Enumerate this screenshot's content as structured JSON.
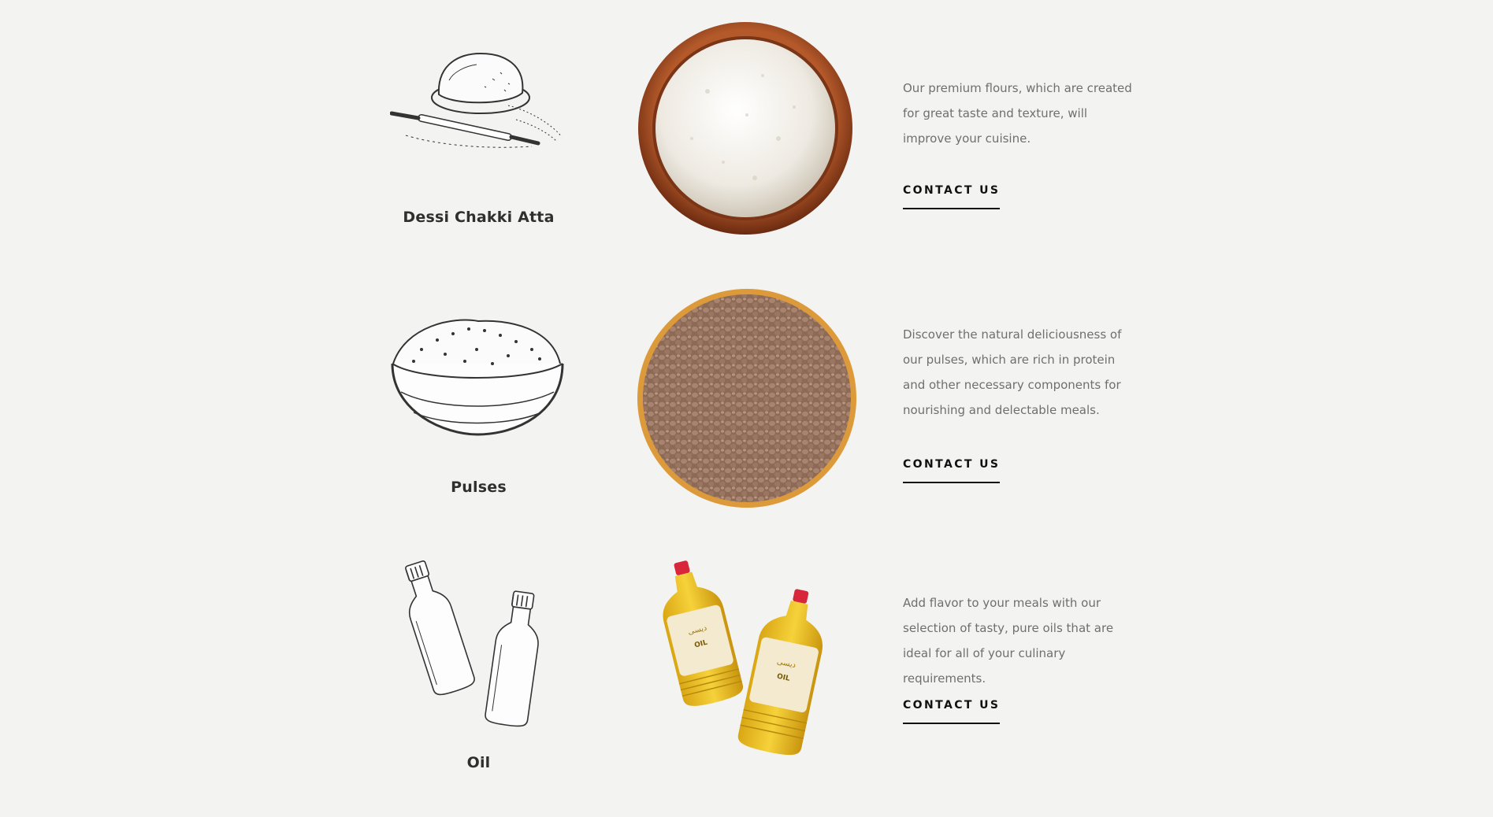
{
  "products": [
    {
      "name": "Dessi Chakki Atta",
      "description": "Our premium flours, which are created for great taste and texture, will improve your cuisine.",
      "cta_label": "CONTACT US",
      "sketch_icon": "dough-rolling-pin-icon",
      "photo": "flour-bowl"
    },
    {
      "name": "Pulses",
      "description": "Discover the natural deliciousness of our pulses, which are rich in protein and other necessary components for nourishing and delectable meals.",
      "cta_label": "CONTACT US",
      "sketch_icon": "bowl-of-grains-icon",
      "photo": "lentils-bowl"
    },
    {
      "name": "Oil",
      "description": "Add flavor to your meals with our selection of tasty, pure oils that are ideal for all of your culinary requirements.",
      "cta_label": "CONTACT US",
      "sketch_icon": "oil-bottles-icon",
      "photo": "oil-bottles"
    }
  ],
  "colors": {
    "background": "#f3f3f2",
    "heading": "#2f2f2f",
    "body_text": "#6f6f6f",
    "cta": "#111111",
    "bowl_wood": "#8a3d1a",
    "lentil_rim": "#d99535",
    "oil_yellow": "#f2cb2a",
    "cap_red": "#d8263a"
  }
}
